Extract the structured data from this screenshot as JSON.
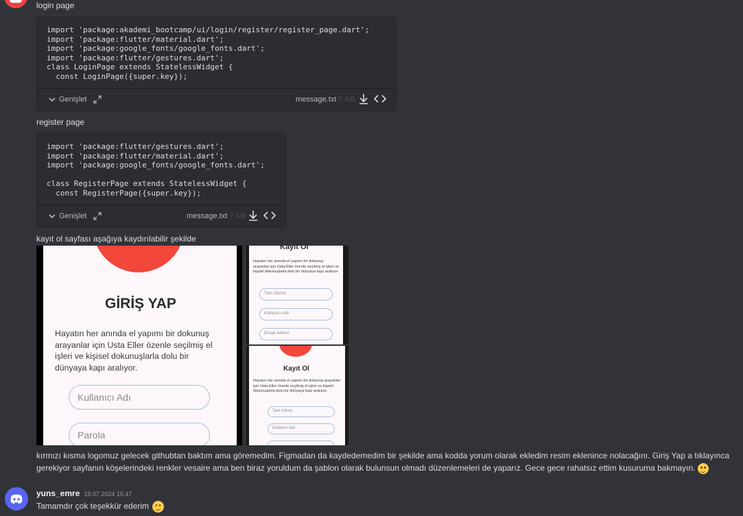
{
  "messages": [
    {
      "text": "login page"
    },
    {
      "text": "register page"
    },
    {
      "text": "kayıt ol sayfası aşağıya kaydırılabilir şekilde"
    }
  ],
  "code_blocks": [
    {
      "lines": "import 'package:akademi_bootcamp/ui/login/register/register_page.dart';\nimport 'package:flutter/material.dart';\nimport 'package:google_fonts/google_fonts.dart';\nimport 'package:flutter/gestures.dart';\nclass LoginPage extends StatelessWidget {\n  const LoginPage({super.key});",
      "expand_label": "Genişlet",
      "filename": "message.txt",
      "size": "5 KB"
    },
    {
      "lines": "import 'package:flutter/gestures.dart';\nimport 'package:flutter/material.dart';\nimport 'package:google_fonts/google_fonts.dart';\n\nclass RegisterPage extends StatelessWidget {\n  const RegisterPage({super.key});",
      "expand_label": "Genişlet",
      "filename": "message.txt",
      "size": "7 KB"
    }
  ],
  "attachments": {
    "login": {
      "title": "GİRİŞ YAP",
      "description": "Hayatın her anında el yapımı bir dokunuş arayanlar için Usta Eller özenle seçilmiş el işleri ve kişisel dokunuşlarla dolu bir dünyaya kapı aralıyor.",
      "fields": [
        "Kullanıcı Adı",
        "Parola"
      ]
    },
    "register_top": {
      "title": "Kayıt Ol",
      "description": "Hayatın her anında el yapımı bir dokunuş arayanlar için Usta Eller özenle seçilmiş el işleri ve kişisel dokunuşlarla dolu bir dünyaya kapı aralıyor.",
      "fields": [
        "Tam Adınız",
        "Kullanıcı Adı",
        "Email Adresi"
      ]
    },
    "register_bottom": {
      "title": "Kayıt Ol",
      "description": "Hayatın her anında el yapımı bir dokunuş arayanlar için Usta Eller özenle seçilmiş el işleri ve kişisel dokunuşlarla dolu bir dünyaya kapı aralıyor.",
      "fields": [
        "Tam Adınız",
        "Kullanıcı Adı"
      ]
    }
  },
  "long_message": {
    "line1": "kırmızı kısma logomuz gelecek githubtan baktım ama göremedim. Figmadan da kaydedemedim bir şekilde ama kodda yorum olarak ekledim resim eklenince nolacağını. Giriş Yap a tıklayınca",
    "line2": "gerekiyor sayfanın köşelerindeki renkler  vesaire ama ben biraz yoruldum  da şablon olarak bulunsun olmadı düzenlemeleri de yaparız. Gece gece rahatsız ettim kusuruma bakmayın.",
    "emoji": "slightly-smiling-face"
  },
  "reply": {
    "username": "yuns_emre",
    "timestamp": "19.07.2024 15:47",
    "text": "Tamamdır çok teşekkür ederim",
    "emoji": "slightly-smiling-face"
  },
  "colors": {
    "background": "#313338",
    "code_block": "#2b2d31",
    "accent_red": "#f2473a",
    "discord_blurple": "#5865f2"
  }
}
